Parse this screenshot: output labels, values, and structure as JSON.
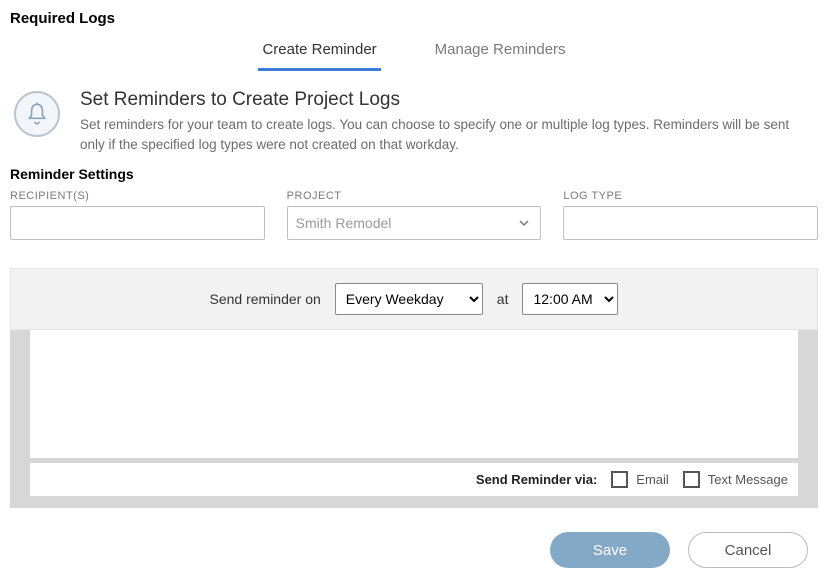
{
  "pageTitle": "Required Logs",
  "tabs": {
    "create": "Create Reminder",
    "manage": "Manage Reminders"
  },
  "intro": {
    "heading": "Set Reminders to Create Project Logs",
    "body": "Set reminders for your team to create logs. You can choose to specify one or multiple log types. Reminders will be sent only if the specified log types were not created on that workday."
  },
  "sectionTitle": "Reminder Settings",
  "fields": {
    "recipients": {
      "label": "RECIPIENT(S)",
      "value": ""
    },
    "project": {
      "label": "PROJECT",
      "selected": "Smith Remodel"
    },
    "logType": {
      "label": "LOG TYPE",
      "value": ""
    }
  },
  "schedule": {
    "prefix": "Send reminder on",
    "frequency": "Every Weekday",
    "at": "at",
    "time": "12:00 AM"
  },
  "sendVia": {
    "label": "Send Reminder via:",
    "email": "Email",
    "text": "Text Message"
  },
  "buttons": {
    "save": "Save",
    "cancel": "Cancel"
  }
}
